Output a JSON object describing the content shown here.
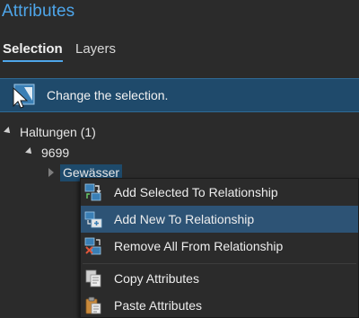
{
  "pane": {
    "title": "Attributes"
  },
  "tabs": [
    {
      "label": "Selection",
      "selected": true
    },
    {
      "label": "Layers",
      "selected": false
    }
  ],
  "banner": {
    "text": "Change the selection.",
    "icon": "select-cursor-icon"
  },
  "tree": {
    "layer": {
      "label": "Haltungen (1)",
      "expanded": true
    },
    "feature": {
      "label": "9699",
      "expanded": true
    },
    "relation": {
      "label": "Gewässer",
      "expanded": false,
      "selected": true
    }
  },
  "context_menu": {
    "items": [
      {
        "label": "Add Selected To Relationship",
        "icon": "add-selected-relationship-icon"
      },
      {
        "label": "Add New To Relationship",
        "icon": "add-new-relationship-icon",
        "highlighted": true
      },
      {
        "label": "Remove All From Relationship",
        "icon": "remove-relationship-icon"
      },
      {
        "label": "Copy Attributes",
        "icon": "copy-icon"
      },
      {
        "label": "Paste Attributes",
        "icon": "paste-icon"
      }
    ]
  }
}
